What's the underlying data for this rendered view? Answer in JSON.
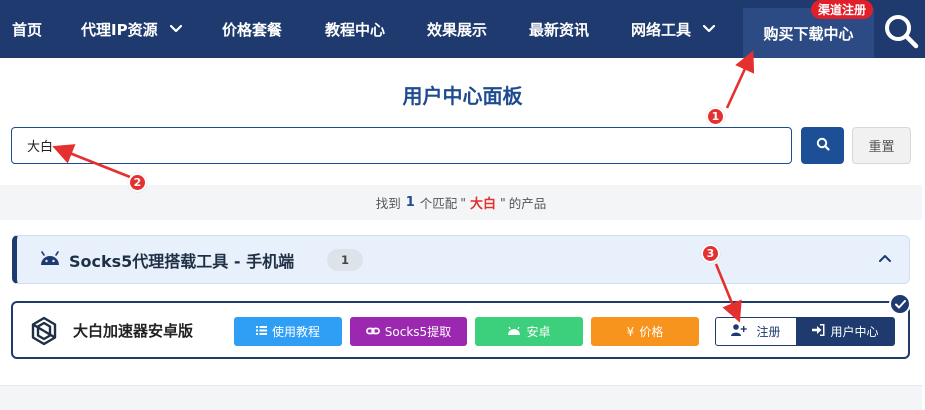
{
  "nav": {
    "items": [
      {
        "label": "首页",
        "has_dropdown": false
      },
      {
        "label": "代理IP资源",
        "has_dropdown": true
      },
      {
        "label": "价格套餐",
        "has_dropdown": false
      },
      {
        "label": "教程中心",
        "has_dropdown": false
      },
      {
        "label": "效果展示",
        "has_dropdown": false
      },
      {
        "label": "最新资讯",
        "has_dropdown": false
      },
      {
        "label": "网络工具",
        "has_dropdown": true
      }
    ],
    "buy_label": "购买下载中心",
    "register_badge": "渠道注册",
    "search_icon": "search-icon"
  },
  "page_title": "用户中心面板",
  "search": {
    "value": "大白",
    "submit_icon": "search-icon",
    "reset_label": "重置"
  },
  "result": {
    "prefix": "找到",
    "count": "1",
    "middle": "个匹配",
    "quote_open": "\"",
    "keyword": "大白",
    "quote_close": "\"",
    "suffix": "的产品"
  },
  "category": {
    "icon": "android-icon",
    "title": "Socks5代理搭载工具 - 手机端",
    "count": "1"
  },
  "product": {
    "name": "大白加速器安卓版",
    "buttons": {
      "tutorial": "使用教程",
      "socks5": "Socks5提取",
      "android": "安卓",
      "price_symbol": "¥",
      "price": "价格",
      "register": "注册",
      "user_center": "用户中心"
    }
  },
  "annotations": [
    "1",
    "2",
    "3"
  ],
  "colors": {
    "nav_bg": "#1e3a6e",
    "accent_red": "#e01f2a",
    "tutorial": "#2e9ff5",
    "socks5": "#9c27b0",
    "android": "#3ccf7c",
    "price": "#f7941d"
  }
}
